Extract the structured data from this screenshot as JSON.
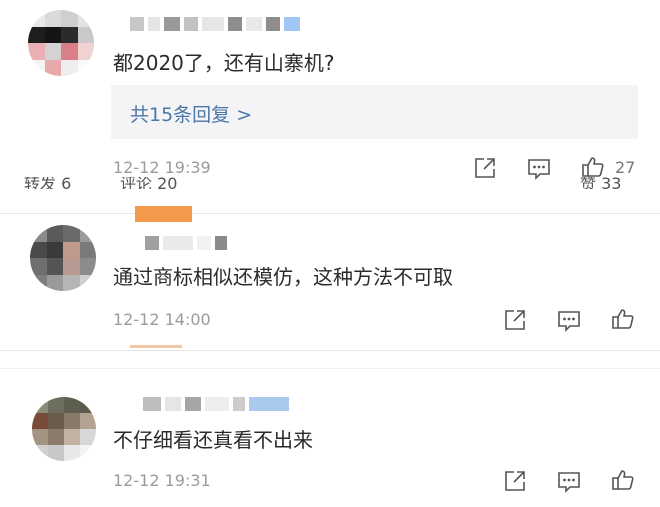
{
  "comments": [
    {
      "text": "都2020了，还有山寨机?",
      "replies_label": "共15条回复 >",
      "timestamp": "12-12 19:39",
      "like_count": "27"
    },
    {
      "text": "通过商标相似还模仿，这种方法不可取",
      "timestamp": "12-12 14:00"
    },
    {
      "text": "不仔细看还真看不出来",
      "timestamp": "12-12 19:31"
    }
  ],
  "partial_row": {
    "left_text": "转发 6",
    "middle_text": "评论 20",
    "right_text": "赞 33"
  },
  "icons": {
    "repost": "share-external-icon",
    "comment": "comment-bubble-icon",
    "like": "thumbs-up-icon"
  },
  "colors": {
    "link": "#4a76a8",
    "reply_bg": "#f4f4f6",
    "timestamp": "#9b9b9b",
    "divider": "#e6e6e6",
    "icon": "#555555"
  }
}
